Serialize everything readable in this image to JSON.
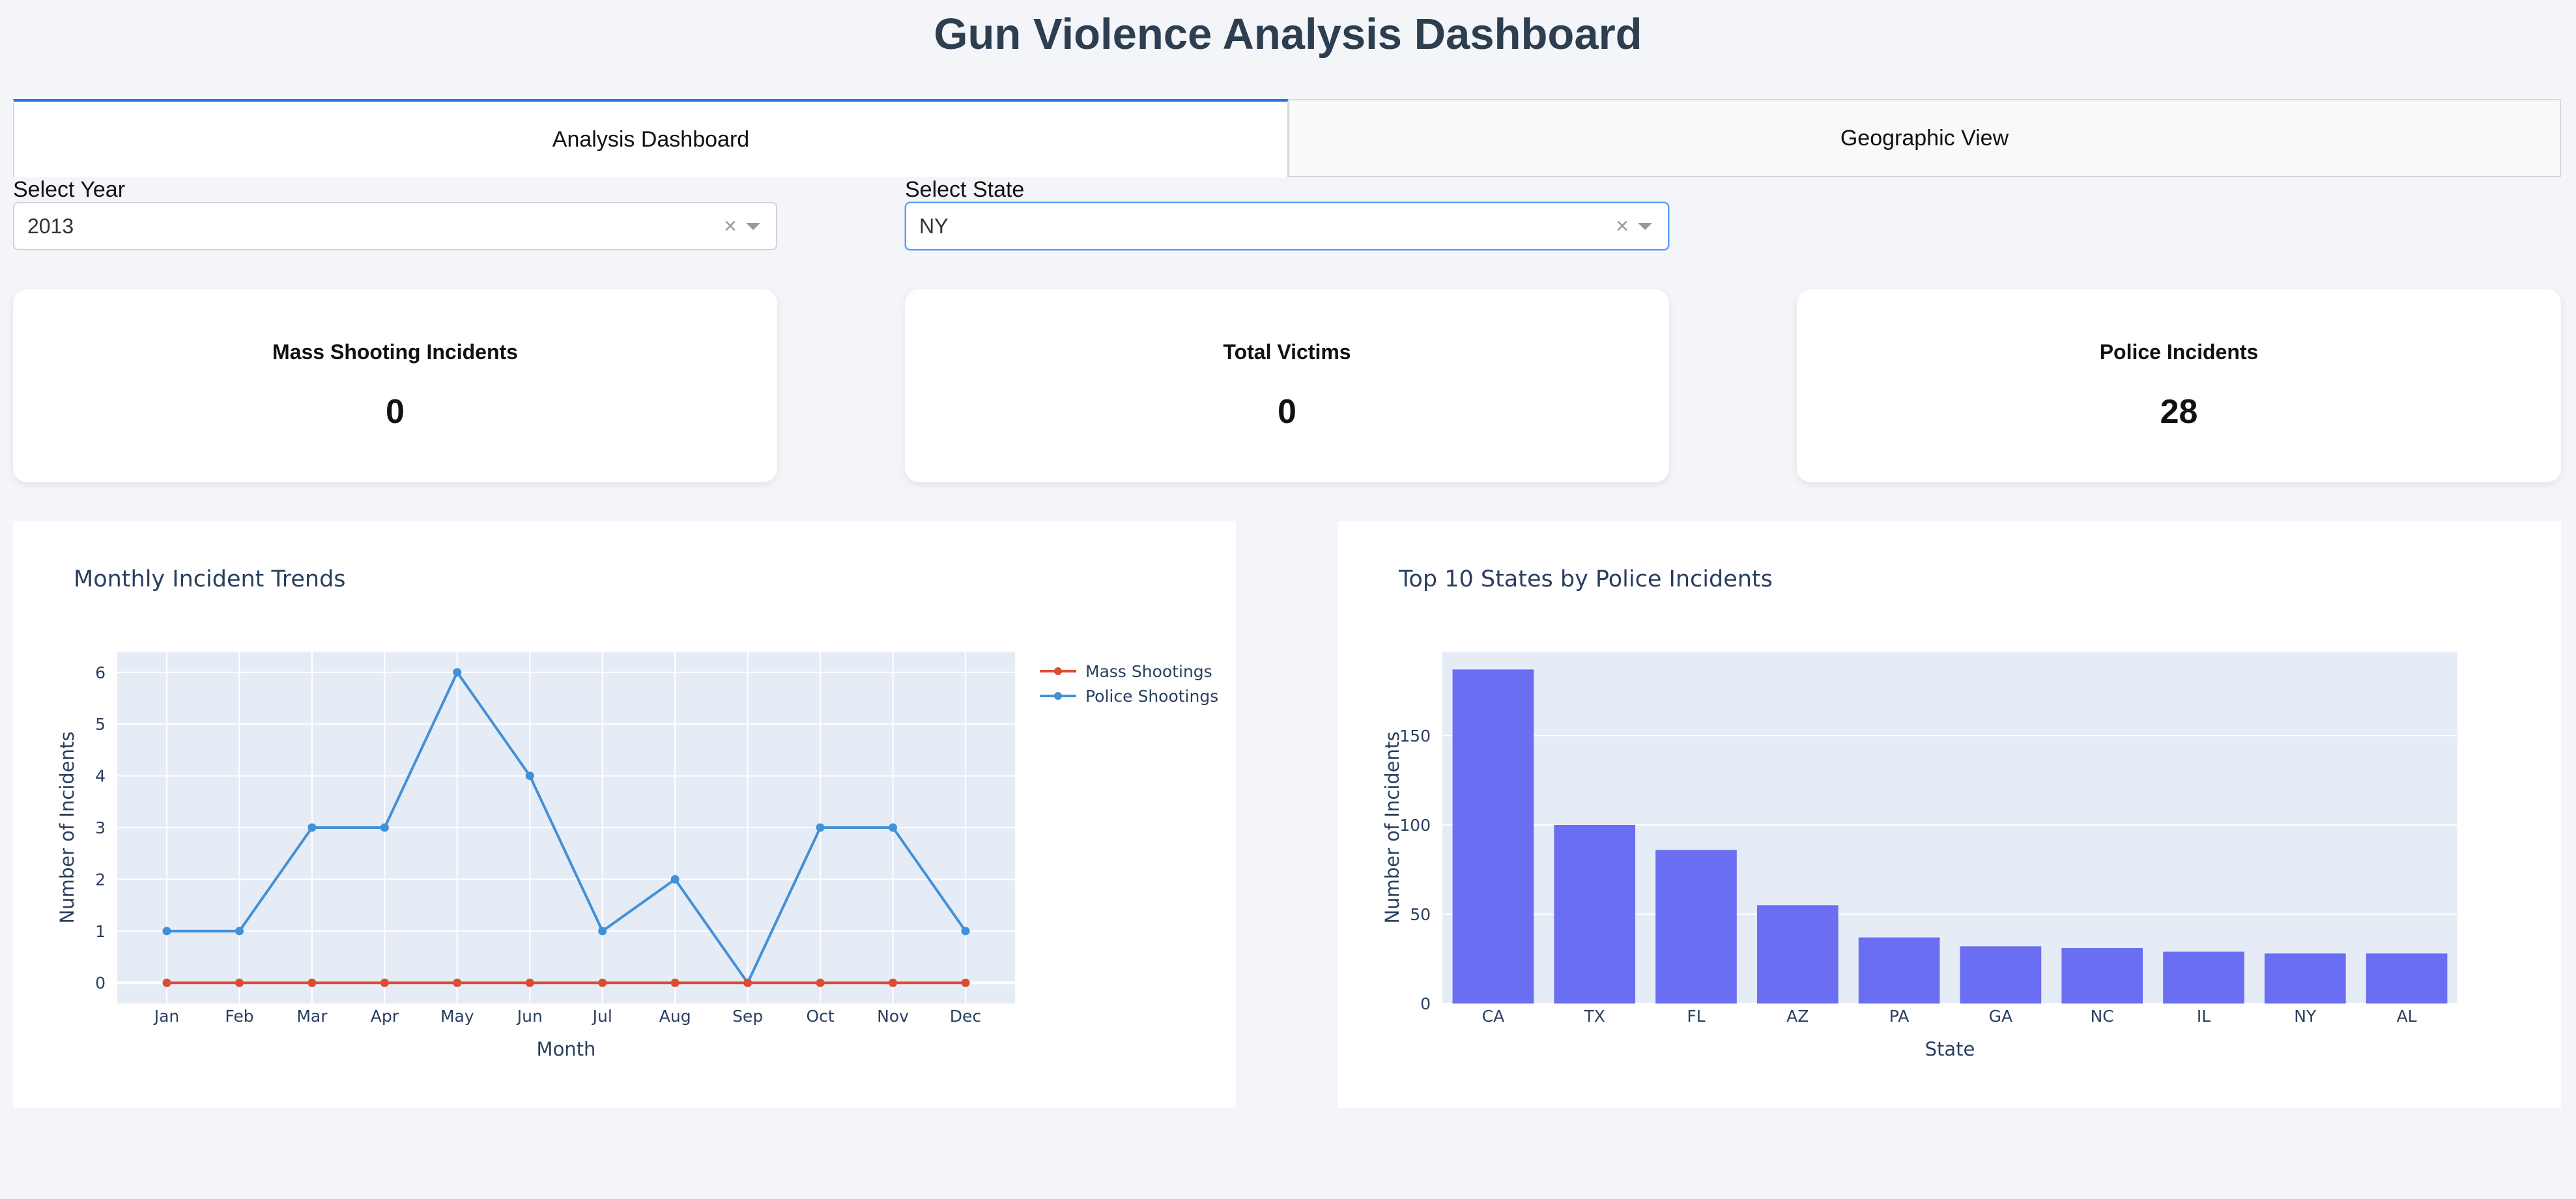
{
  "header": {
    "title": "Gun Violence Analysis Dashboard"
  },
  "tabs": [
    {
      "label": "Analysis Dashboard",
      "active": true
    },
    {
      "label": "Geographic View",
      "active": false
    }
  ],
  "filters": {
    "year": {
      "label": "Select Year",
      "value": "2013",
      "clear": "×"
    },
    "state": {
      "label": "Select State",
      "value": "NY",
      "clear": "×"
    }
  },
  "cards": [
    {
      "title": "Mass Shooting Incidents",
      "value": "0"
    },
    {
      "title": "Total Victims",
      "value": "0"
    },
    {
      "title": "Police Incidents",
      "value": "28"
    }
  ],
  "colors": {
    "accent": "#1f77e6",
    "mass": "#dc4b34",
    "police": "#4290d8",
    "bar": "#6a6ef2",
    "plotbg": "#e5ecf6"
  },
  "chart_data": [
    {
      "type": "line",
      "title": "Monthly Incident Trends",
      "xlabel": "Month",
      "ylabel": "Number of Incidents",
      "categories": [
        "Jan",
        "Feb",
        "Mar",
        "Apr",
        "May",
        "Jun",
        "Jul",
        "Aug",
        "Sep",
        "Oct",
        "Nov",
        "Dec"
      ],
      "series": [
        {
          "name": "Mass Shootings",
          "color": "#dc4b34",
          "values": [
            0,
            0,
            0,
            0,
            0,
            0,
            0,
            0,
            0,
            0,
            0,
            0
          ]
        },
        {
          "name": "Police Shootings",
          "color": "#4290d8",
          "values": [
            1,
            1,
            3,
            3,
            6,
            4,
            1,
            2,
            0,
            3,
            3,
            1
          ]
        }
      ],
      "ylim": [
        -0.4,
        6.4
      ],
      "yticks": [
        0,
        1,
        2,
        3,
        4,
        5,
        6
      ],
      "grid": true,
      "legend": "top-right"
    },
    {
      "type": "bar",
      "title": "Top 10 States by Police Incidents",
      "xlabel": "State",
      "ylabel": "Number of Incidents",
      "categories": [
        "CA",
        "TX",
        "FL",
        "AZ",
        "PA",
        "GA",
        "NC",
        "IL",
        "NY",
        "AL"
      ],
      "values": [
        187,
        100,
        86,
        55,
        37,
        32,
        31,
        29,
        28,
        28
      ],
      "ylim": [
        0,
        197
      ],
      "yticks": [
        0,
        50,
        100,
        150
      ],
      "grid": true
    }
  ]
}
